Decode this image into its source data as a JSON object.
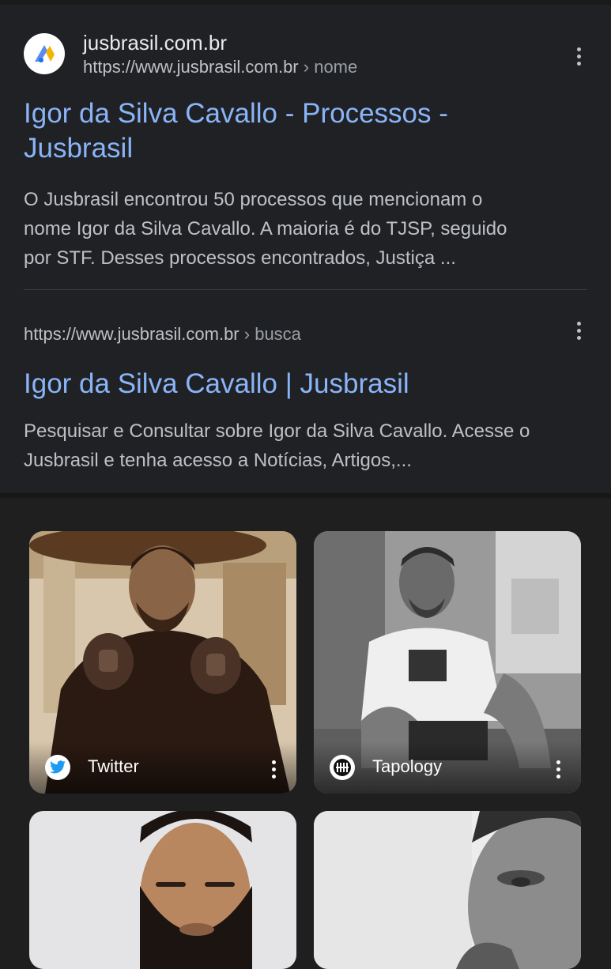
{
  "results": [
    {
      "site_name": "jusbrasil.com.br",
      "url": "https://www.jusbrasil.com.br",
      "breadcrumb": "› nome",
      "title_line1": "Igor da Silva Cavallo - Processos -",
      "title_line2": "Jusbrasil",
      "snippet_line1": "O Jusbrasil encontrou 50 processos que mencionam o",
      "snippet_line2": "nome Igor da Silva Cavallo. A maioria é do TJSP, seguido",
      "snippet_line3": "por STF. Desses processos encontrados, Justiça ...",
      "favicon": "jusbrasil-logo-icon"
    },
    {
      "url": "https://www.jusbrasil.com.br",
      "breadcrumb": "› busca",
      "title": "Igor da Silva Cavallo | Jusbrasil",
      "snippet_line1": "Pesquisar e Consultar sobre Igor da Silva Cavallo. Acesse o",
      "snippet_line2": "Jusbrasil e tenha acesso a Notícias, Artigos,..."
    }
  ],
  "images": [
    {
      "source": "Twitter",
      "icon": "twitter-bird-icon",
      "photo": "sepia portrait, man in black gi with MMA gloves"
    },
    {
      "source": "Tapology",
      "icon": "tapology-icon",
      "photo": "black-and-white, man sitting in t-shirt and shorts"
    },
    {
      "source": "",
      "photo": "bearded man portrait on light background"
    },
    {
      "source": "",
      "photo": "black-and-white close-up portrait"
    }
  ],
  "colors": {
    "link": "#8ab4f8",
    "background": "#202124",
    "text": "#bdc1c6"
  }
}
